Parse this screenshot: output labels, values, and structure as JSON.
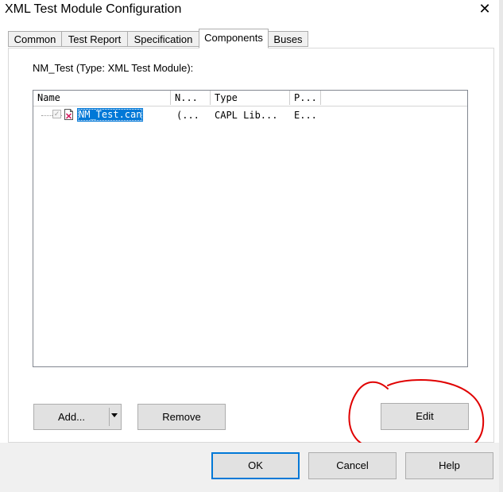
{
  "window": {
    "title": "XML Test Module Configuration",
    "close_glyph": "✕",
    "close_icon": "close-icon"
  },
  "tabs": [
    {
      "label": "Common",
      "active": false
    },
    {
      "label": "Test Report",
      "active": false
    },
    {
      "label": "Specification",
      "active": false
    },
    {
      "label": "Components",
      "active": true
    },
    {
      "label": "Buses",
      "active": false
    }
  ],
  "components": {
    "module_label": "NM_Test (Type: XML Test Module):",
    "columns": [
      "Name",
      "N...",
      "Type",
      "P..."
    ],
    "rows": [
      {
        "name": "NM_Test.can",
        "n": "(...",
        "type": "CAPL Lib...",
        "p": "E...",
        "checked": true,
        "selected": true,
        "icon": "can-file-icon"
      }
    ],
    "add_label": "Add...",
    "remove_label": "Remove",
    "edit_label": "Edit",
    "annotation_color": "#e00000"
  },
  "footer": {
    "ok_label": "OK",
    "cancel_label": "Cancel",
    "help_label": "Help"
  },
  "colors": {
    "accent": "#0078d7",
    "button_face": "#e1e1e1",
    "dialog_bg": "#f0f0f0"
  }
}
